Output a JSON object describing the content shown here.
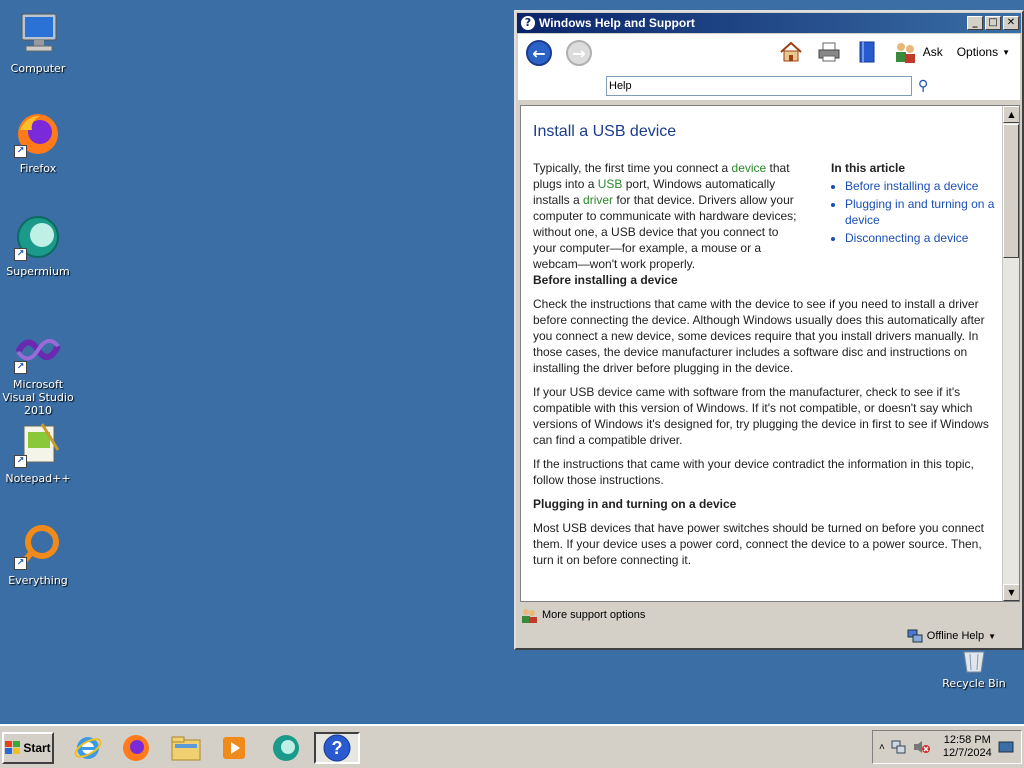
{
  "desktop": {
    "icons": [
      {
        "label": "Computer"
      },
      {
        "label": "Firefox"
      },
      {
        "label": "Supermium"
      },
      {
        "label": "Microsoft Visual Studio 2010"
      },
      {
        "label": "Notepad++"
      },
      {
        "label": "Everything"
      }
    ],
    "recycle_bin": "Recycle Bin"
  },
  "window": {
    "title": "Windows Help and Support",
    "toolbar": {
      "ask_label": "Ask",
      "options_label": "Options"
    },
    "search": {
      "value": "Help"
    },
    "article": {
      "title": "Install a USB device",
      "intro_1": "Typically, the first time you connect a ",
      "intro_link_device": "device",
      "intro_2": " that plugs into a ",
      "intro_link_usb": "USB",
      "intro_3": " port, Windows automatically installs a ",
      "intro_link_driver": "driver",
      "intro_4": " for that device. Drivers allow your computer to communicate with hardware devices; without one, a USB device that you connect to your computer—for example, a mouse or a webcam—won't work properly.",
      "in_this_article": "In this article",
      "toc": [
        "Before installing a device",
        "Plugging in and turning on a device",
        "Disconnecting a device"
      ],
      "section1_heading": "Before installing a device",
      "section1_p1": "Check the instructions that came with the device to see if you need to install a driver before connecting the device. Although Windows usually does this automatically after you connect a new device, some devices require that you install drivers manually. In those cases, the device manufacturer includes a software disc and instructions on installing the driver before plugging in the device.",
      "section1_p2": "If your USB device came with software from the manufacturer, check to see if it's compatible with this version of Windows. If it's not compatible, or doesn't say which versions of Windows it's designed for, try plugging the device in first to see if Windows can find a compatible driver.",
      "section1_p3": "If the instructions that came with your device contradict the information in this topic, follow those instructions.",
      "section2_heading": "Plugging in and turning on a device",
      "section2_p1": "Most USB devices that have power switches should be turned on before you connect them. If your device uses a power cord, connect the device to a power source. Then, turn it on before connecting it."
    },
    "footer": {
      "more_support": "More support options",
      "offline_help": "Offline Help"
    }
  },
  "taskbar": {
    "start_label": "Start",
    "clock_time": "12:58 PM",
    "clock_date": "12/7/2024"
  }
}
